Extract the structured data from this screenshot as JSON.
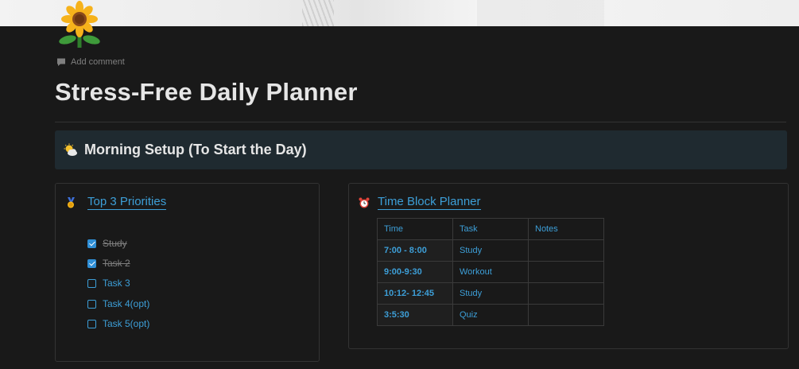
{
  "page": {
    "icon": "sunflower-icon",
    "add_comment": "Add comment",
    "title": "Stress-Free Daily Planner"
  },
  "callout": {
    "icon": "sun-behind-cloud-icon",
    "text": "Morning Setup (To Start the Day)"
  },
  "priorities": {
    "icon": "medal-icon",
    "heading": "Top 3 Priorities",
    "items": [
      {
        "label": "Study",
        "checked": true
      },
      {
        "label": "Task 2",
        "checked": true
      },
      {
        "label": "Task 3",
        "checked": false
      },
      {
        "label": "Task 4(opt)",
        "checked": false
      },
      {
        "label": "Task 5(opt)",
        "checked": false
      }
    ]
  },
  "time_block": {
    "icon": "alarm-clock-icon",
    "heading": "Time Block Planner",
    "columns": [
      "Time",
      "Task",
      "Notes"
    ],
    "rows": [
      {
        "time": "7:00 - 8:00",
        "task": "Study",
        "notes": ""
      },
      {
        "time": "9:00-9:30",
        "task": "Workout",
        "notes": ""
      },
      {
        "time": "10:12- 12:45",
        "task": "Study",
        "notes": ""
      },
      {
        "time": "3:5:30",
        "task": "Quiz",
        "notes": ""
      }
    ]
  },
  "colors": {
    "background": "#191919",
    "accent": "#3d9fd8",
    "callout_bg": "#1f2a30",
    "title_text": "#e6e6e6"
  }
}
